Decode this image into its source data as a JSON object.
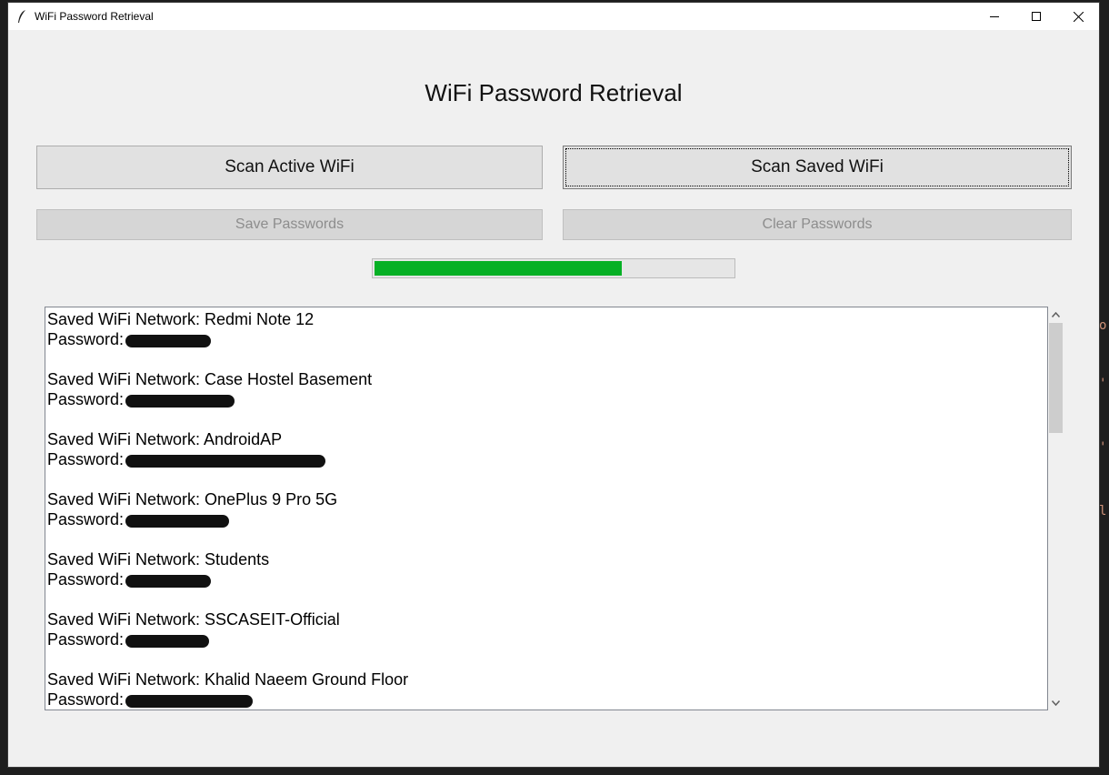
{
  "window": {
    "title": "WiFi Password Retrieval",
    "controls": [
      "minimize",
      "maximize",
      "close"
    ]
  },
  "heading": "WiFi Password Retrieval",
  "buttons": {
    "scan_active": "Scan Active WiFi",
    "scan_saved": "Scan Saved WiFi",
    "save": "Save Passwords",
    "clear": "Clear Passwords"
  },
  "progress": {
    "fraction": 0.69,
    "color": "#06b025"
  },
  "log": {
    "entries": [
      {
        "network_label": "Saved WiFi Network: Redmi Note 12",
        "password_label": "Password:"
      },
      {
        "network_label": "Saved WiFi Network: Case Hostel Basement",
        "password_label": "Password:"
      },
      {
        "network_label": "Saved WiFi Network: AndroidAP",
        "password_label": "Password:"
      },
      {
        "network_label": "Saved WiFi Network: OnePlus 9 Pro 5G",
        "password_label": "Password:"
      },
      {
        "network_label": "Saved WiFi Network: Students",
        "password_label": "Password:"
      },
      {
        "network_label": "Saved WiFi Network: SSCASEIT-Official",
        "password_label": "Password:"
      },
      {
        "network_label": "Saved WiFi Network: Khalid Naeem Ground Floor",
        "password_label": "Password:"
      }
    ]
  },
  "colors": {
    "window_bg": "#f0f0f0",
    "button_bg": "#e1e1e1",
    "disabled_text": "#8d8d8d"
  }
}
